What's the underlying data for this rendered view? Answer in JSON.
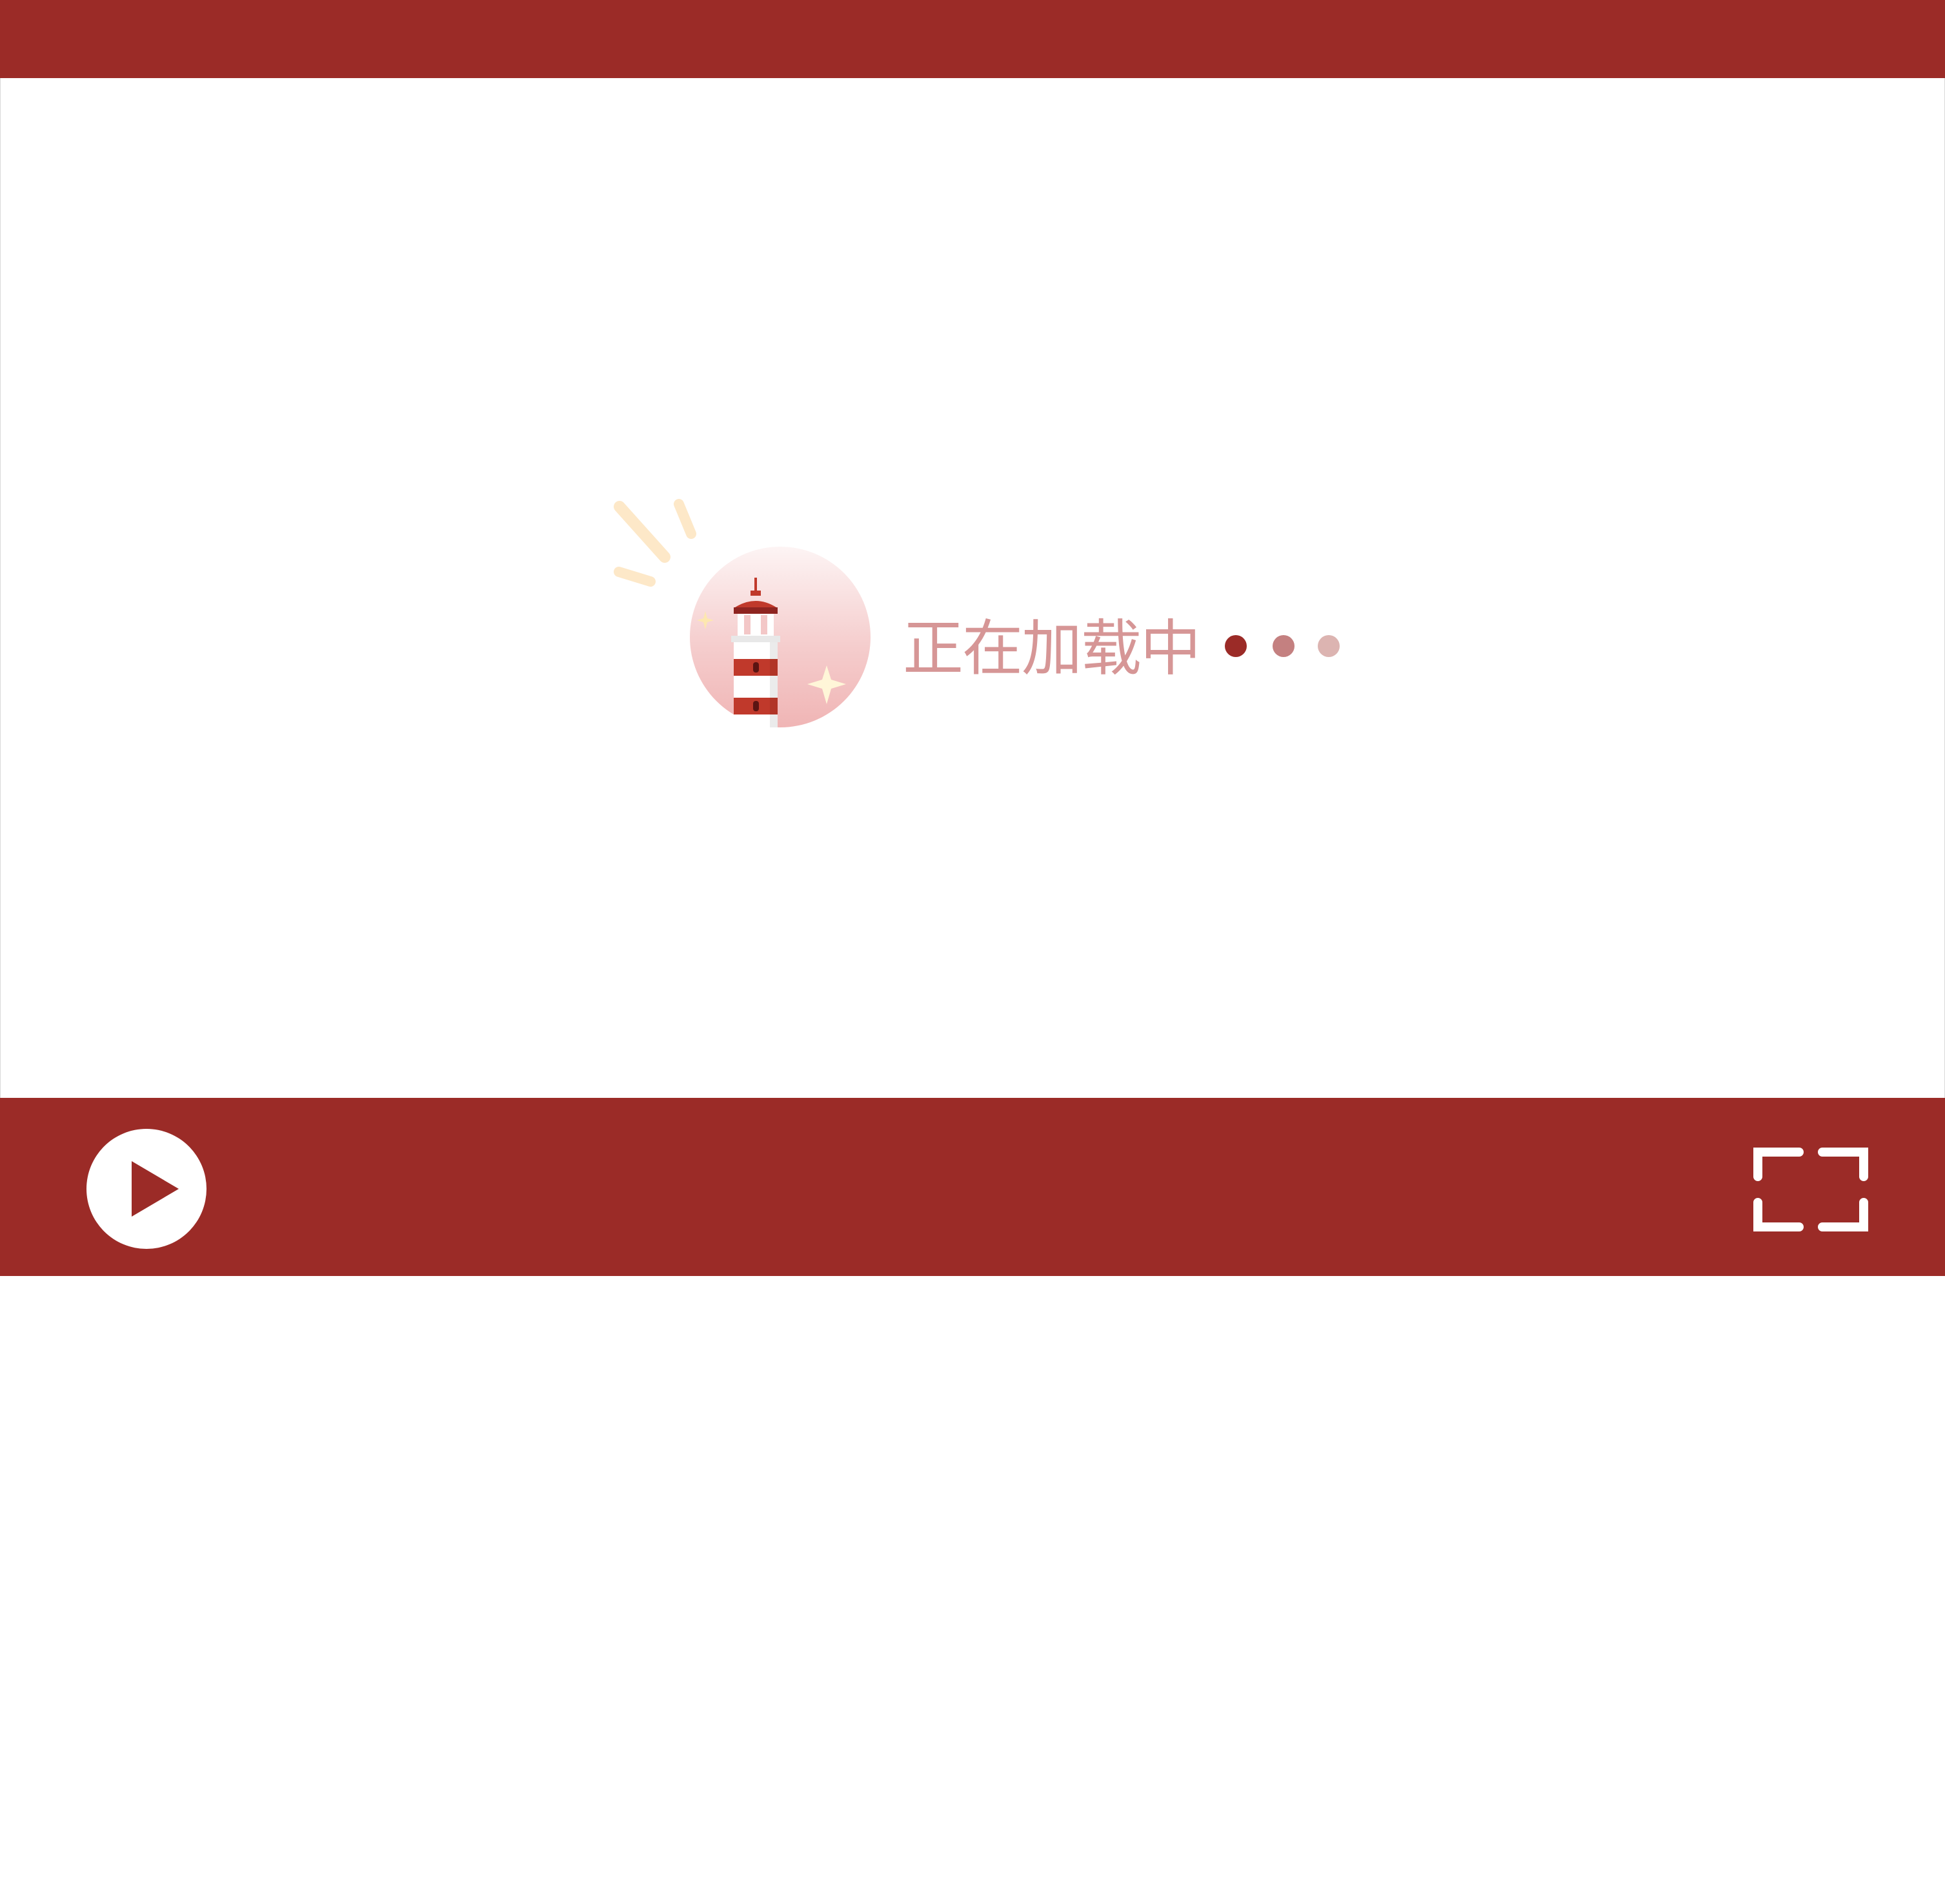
{
  "player": {
    "loading_text": "正在加载中",
    "colors": {
      "bar": "#9b2b27",
      "loading_text": "#d69696",
      "dot_1": "#9b2b27",
      "dot_2": "#c48080",
      "dot_3": "#dcb4b1",
      "icon": "#ffffff"
    },
    "controls": {
      "play_icon": "play-icon",
      "fullscreen_icon": "fullscreen-icon"
    },
    "loader_art": "lighthouse-illustration"
  }
}
